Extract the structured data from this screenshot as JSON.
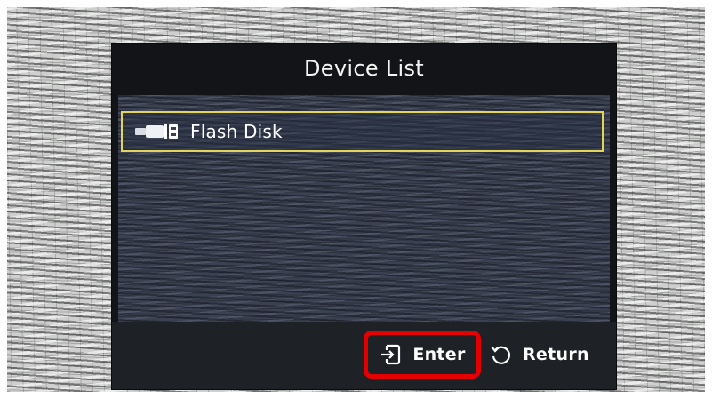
{
  "dialog": {
    "title": "Device List",
    "devices": [
      {
        "label": "Flash Disk",
        "icon": "usb-drive-icon",
        "selected": true
      }
    ]
  },
  "footer": {
    "enter_label": "Enter",
    "enter_icon": "enter-icon",
    "return_label": "Return",
    "return_icon": "return-icon"
  },
  "colors": {
    "selection_border": "#e3d55a",
    "highlight_annotation": "#e40000",
    "dialog_background": "#121418",
    "text": "#ffffff"
  }
}
